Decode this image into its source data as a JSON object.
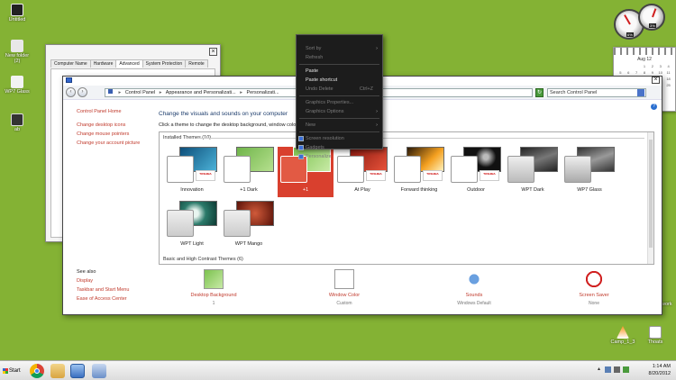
{
  "desktop": {
    "icons_left": [
      {
        "label": "Untitled"
      },
      {
        "label": "New folder (2)"
      },
      {
        "label": "WP7 Glass"
      },
      {
        "label": "ab"
      }
    ],
    "icons_bottom_right": [
      {
        "label": "Camp_1_3"
      },
      {
        "label": "Thoats"
      }
    ],
    "right_edge_label": "work"
  },
  "gadgets": {
    "calendar": {
      "month": "Aug 12",
      "highlight_color": "#d02020"
    },
    "meter_labels": [
      "6%",
      "3%"
    ]
  },
  "system_window": {
    "tabs": [
      "Computer Name",
      "Hardware",
      "Advanced",
      "System Protection",
      "Remote"
    ],
    "active_tab": "Advanced"
  },
  "control_panel": {
    "breadcrumb": [
      "Control Panel",
      "Appearance and Personalizati...",
      "Personalizati..."
    ],
    "search_placeholder": "Search Control Panel",
    "left_nav": {
      "home": "Control Panel Home",
      "links": [
        "Change desktop icons",
        "Change mouse pointers",
        "Change your account picture"
      ]
    },
    "heading": "Change the visuals and sounds on your computer",
    "subheading": "Click a theme to change the desktop background, window color, sounds, and screen saver all at once.",
    "installed_group": "Installed Themes (10)",
    "basic_group": "Basic and High Contrast Themes (6)",
    "themes": [
      {
        "label": "Innovation",
        "preview": "#2b7fa4",
        "toshiba": "TOSHIBA"
      },
      {
        "label": "+1 Dark",
        "preview": "#8fc96a",
        "toshiba": ""
      },
      {
        "label": "+1",
        "preview": "#9fd07a",
        "toshiba": "",
        "selected": true
      },
      {
        "label": "At Play",
        "preview": "#c93a28",
        "toshiba": "TOSHIBA"
      },
      {
        "label": "Forward thinking",
        "preview": "#e07a1a",
        "toshiba": "TOSHIBA"
      },
      {
        "label": "Outdoor",
        "preview": "#1a1a1a",
        "toshiba": "TOSHIBA"
      },
      {
        "label": "WPT Dark",
        "preview": "#555555",
        "toshiba": ""
      },
      {
        "label": "WP7 Glass",
        "preview": "#6d6d6d",
        "toshiba": ""
      },
      {
        "label": "WPT Light",
        "preview": "#3d8a7a",
        "toshiba": ""
      },
      {
        "label": "WPT Mango",
        "preview": "#8a2a1c",
        "toshiba": ""
      }
    ],
    "see_also": {
      "title": "See also",
      "links": [
        "Display",
        "Taskbar and Start Menu",
        "Ease of Access Center"
      ]
    },
    "bottom_items": [
      {
        "title": "Desktop Background",
        "sub": "1"
      },
      {
        "title": "Window Color",
        "sub": "Custom"
      },
      {
        "title": "Sounds",
        "sub": "Windows Default"
      },
      {
        "title": "Screen Saver",
        "sub": "None"
      }
    ]
  },
  "context_menu": {
    "items": [
      {
        "label": "Sort by",
        "enabled": false,
        "submenu": true
      },
      {
        "label": "Refresh",
        "enabled": false
      },
      {
        "sep": true
      },
      {
        "label": "Paste",
        "enabled": true
      },
      {
        "label": "Paste shortcut",
        "enabled": true
      },
      {
        "label": "Undo Delete",
        "enabled": false,
        "shortcut": "Ctrl+Z"
      },
      {
        "sep": true
      },
      {
        "label": "Graphics Properties...",
        "enabled": false
      },
      {
        "label": "Graphics Options",
        "enabled": false,
        "submenu": true
      },
      {
        "sep": true
      },
      {
        "label": "New",
        "enabled": false,
        "submenu": true
      },
      {
        "sep": true
      },
      {
        "label": "Screen resolution",
        "enabled": false,
        "icon": true
      },
      {
        "label": "Gadgets",
        "enabled": false,
        "icon": true
      },
      {
        "label": "Personalize",
        "enabled": false,
        "icon": true
      }
    ]
  },
  "taskbar": {
    "start_label": "Start",
    "clock_time": "1:14 AM",
    "clock_date": "8/20/2012"
  }
}
